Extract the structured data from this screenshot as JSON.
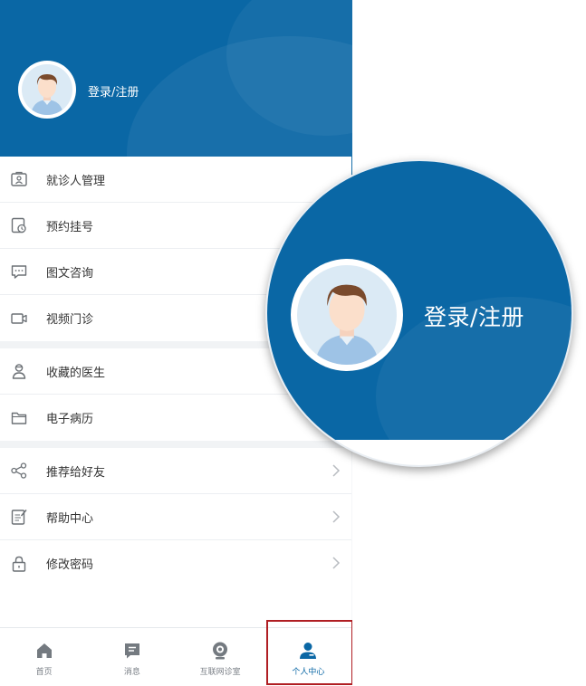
{
  "header": {
    "login_label": "登录/注册"
  },
  "menu": {
    "group1": [
      {
        "label": "就诊人管理",
        "icon": "patient-card-icon"
      },
      {
        "label": "预约挂号",
        "icon": "appointment-icon"
      },
      {
        "label": "图文咨询",
        "icon": "chat-icon"
      },
      {
        "label": "视频门诊",
        "icon": "video-icon"
      }
    ],
    "group2": [
      {
        "label": "收藏的医生",
        "icon": "doctor-icon"
      },
      {
        "label": "电子病历",
        "icon": "folder-icon"
      }
    ],
    "group3": [
      {
        "label": "推荐给好友",
        "icon": "share-icon"
      },
      {
        "label": "帮助中心",
        "icon": "help-doc-icon"
      },
      {
        "label": "修改密码",
        "icon": "lock-icon"
      }
    ]
  },
  "tabbar": {
    "items": [
      {
        "label": "首页",
        "icon": "home-icon"
      },
      {
        "label": "消息",
        "icon": "message-icon"
      },
      {
        "label": "互联网诊室",
        "icon": "clinic-camera-icon"
      },
      {
        "label": "个人中心",
        "icon": "user-icon",
        "active": true
      }
    ]
  },
  "zoom": {
    "login_label": "登录/注册"
  },
  "colors": {
    "primary": "#0a67a5",
    "highlight_border": "#b01e23",
    "icon_gray": "#6b7075"
  }
}
